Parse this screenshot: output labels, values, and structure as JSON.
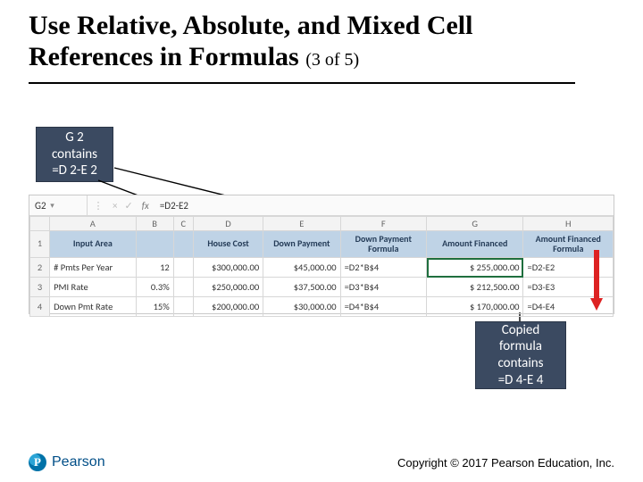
{
  "title": {
    "main": "Use Relative, Absolute, and Mixed Cell References in Formulas",
    "counter": "(3 of 5)"
  },
  "callouts": {
    "top": "G 2\ncontains\n=D 2-E 2",
    "bottom": "Copied\nformula\ncontains\n=D 4-E 4"
  },
  "excel": {
    "name_box": "G2",
    "fx_label": "fx",
    "formula_bar": "=D2-E2",
    "col_letters": [
      "A",
      "B",
      "C",
      "D",
      "E",
      "F",
      "G",
      "H"
    ],
    "headers": {
      "A": "Input Area",
      "B": "",
      "C": "",
      "D": "House Cost",
      "E": "Down Payment",
      "F": "Down Payment Formula",
      "G": "Amount Financed",
      "H": "Amount Financed Formula"
    },
    "rows": [
      {
        "n": "2",
        "A": "# Pmts Per Year",
        "B": "12",
        "D": "$300,000.00",
        "E": "$45,000.00",
        "F": "=D2*B$4",
        "G": "$        255,000.00",
        "H": "=D2-E2"
      },
      {
        "n": "3",
        "A": "PMI Rate",
        "B": "0.3%",
        "D": "$250,000.00",
        "E": "$37,500.00",
        "F": "=D3*B$4",
        "G": "$        212,500.00",
        "H": "=D3-E3"
      },
      {
        "n": "4",
        "A": "Down Pmt Rate",
        "B": "15%",
        "D": "$200,000.00",
        "E": "$30,000.00",
        "F": "=D4*B$4",
        "G": "$        170,000.00",
        "H": "=D4-E4"
      }
    ]
  },
  "footer": {
    "brand_letter": "P",
    "brand": "Pearson",
    "copyright": "Copyright © 2017 Pearson Education, Inc."
  }
}
